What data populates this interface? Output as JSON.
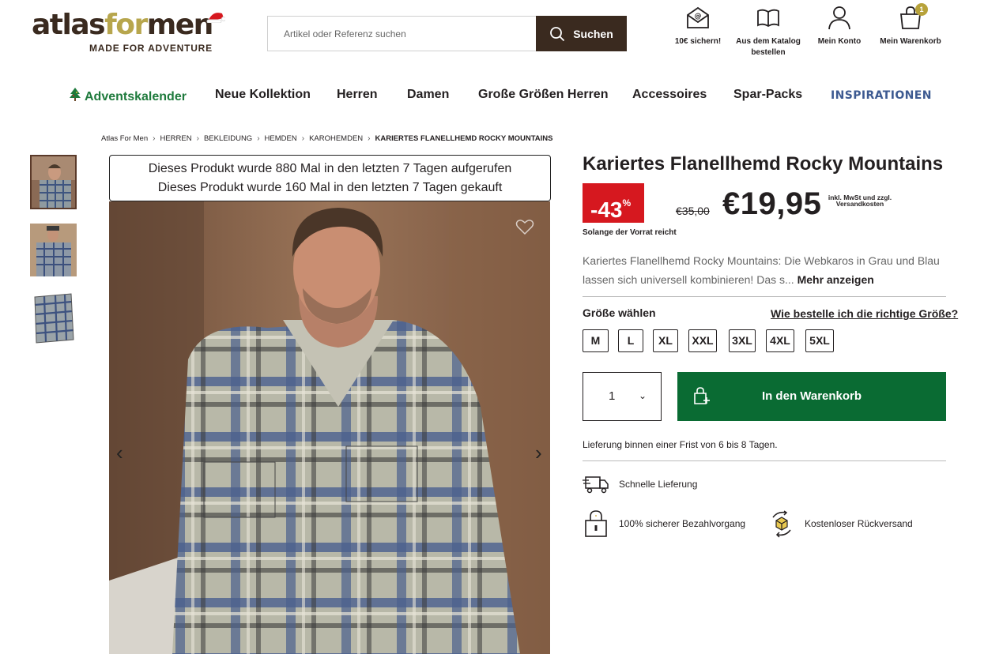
{
  "brand": {
    "logo_part1": "atlas",
    "logo_part2": "for",
    "logo_part3": "men",
    "tagline": "MADE FOR ADVENTURE"
  },
  "search": {
    "placeholder": "Artikel oder Referenz suchen",
    "button_label": "Suchen"
  },
  "header_icons": {
    "voucher": "10€ sichern!",
    "catalog_line1": "Aus dem Katalog",
    "catalog_line2": "bestellen",
    "account": "Mein Konto",
    "cart": "Mein Warenkorb",
    "cart_count": "1"
  },
  "nav": {
    "advent": "Adventskalender",
    "new": "Neue Kollektion",
    "men": "Herren",
    "women": "Damen",
    "big_sizes": "Große Größen Herren",
    "accessories": "Accessoires",
    "packs": "Spar-Packs",
    "inspiration": "INSPIRATIONEN"
  },
  "breadcrumb": [
    "Atlas For Men",
    "HERREN",
    "BEKLEIDUNG",
    "HEMDEN",
    "KAROHEMDEN",
    "KARIERTES FLANELLHEMD ROCKY MOUNTAINS"
  ],
  "gallery": {
    "views_line1": "Dieses Produkt wurde 880 Mal in den letzten 7 Tagen aufgerufen",
    "views_line2": "Dieses Produkt wurde 160 Mal in den letzten 7 Tagen gekauft",
    "prev": "‹",
    "next": "›"
  },
  "product": {
    "title": "Kariertes Flanellhemd Rocky Mountains",
    "discount": "-43",
    "discount_unit": "%",
    "stock_note": "Solange der Vorrat reicht",
    "old_price": "€35,00",
    "price": "€19,95",
    "tax_line1": "inkl. MwSt und zzgl.",
    "tax_line2": "Versandkosten",
    "description": "Kariertes Flanellhemd Rocky Mountains: Die Webkaros in Grau und Blau lassen sich universell kombinieren! Das s...",
    "more": "Mehr anzeigen",
    "size_label": "Größe wählen",
    "size_help": "Wie bestelle ich die richtige Größe?",
    "sizes": [
      "M",
      "L",
      "XL",
      "XXL",
      "3XL",
      "4XL",
      "5XL"
    ],
    "quantity": "1",
    "add_to_cart": "In den Warenkorb",
    "delivery": "Lieferung binnen einer Frist von 6 bis 8 Tagen.",
    "feature_fast": "Schnelle Lieferung",
    "feature_secure": "100% sicherer Bezahlvorgang",
    "feature_return": "Kostenloser Rückversand"
  },
  "colors": {
    "brand_brown": "#3a2a1f",
    "brand_gold": "#b7a64d",
    "cart_green": "#0a6b33",
    "sale_red": "#d6181f",
    "advent_green": "#1e7a3c",
    "inspiration_blue": "#3d5a91"
  }
}
